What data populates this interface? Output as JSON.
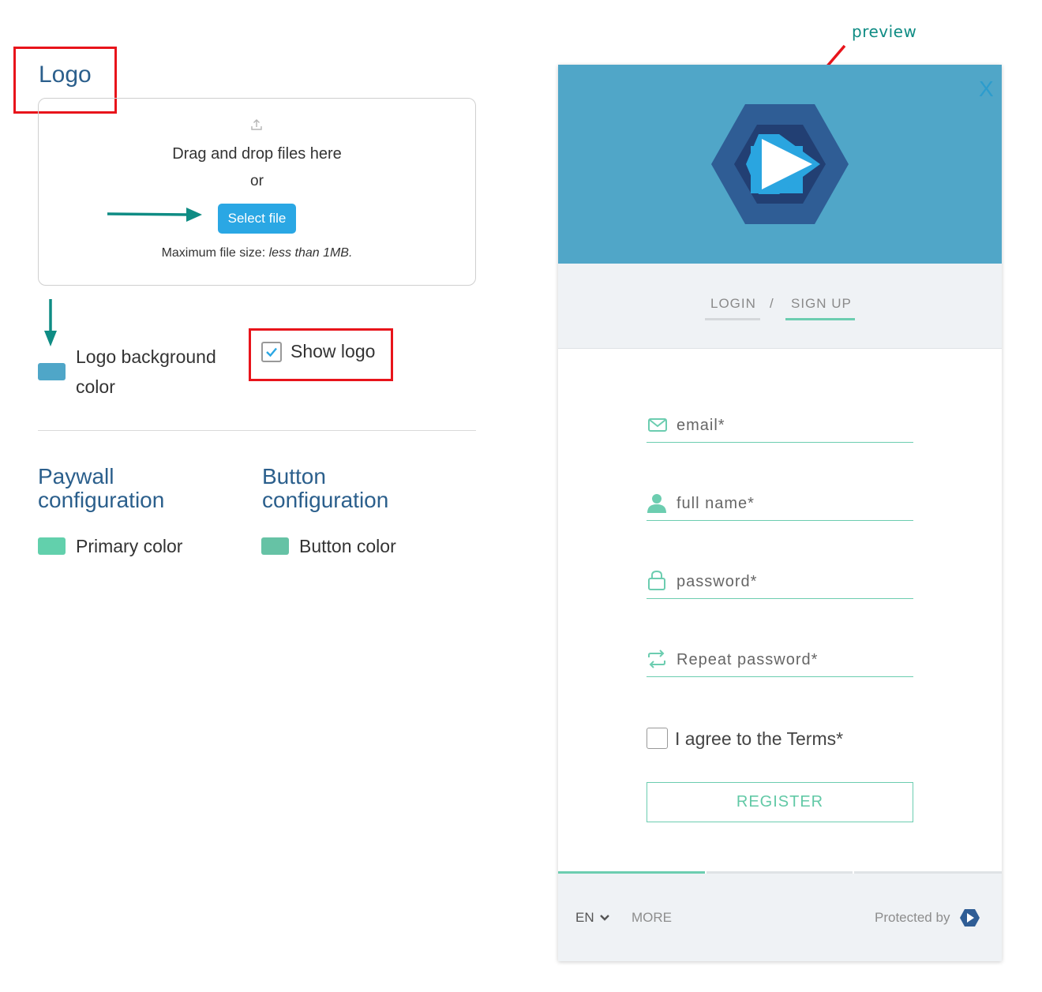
{
  "colors": {
    "heading": "#2b5f8c",
    "highlight_box": "#e8141b",
    "annotation_arrow": "#0f8c84",
    "select_button": "#2aa7e4",
    "logo_background": "#4fa6c8",
    "primary": "#62d0ac",
    "button": "#66c2a5",
    "accent": "#6ccdb0"
  },
  "logo_section": {
    "title": "Logo",
    "upload": {
      "icon": "upload-icon",
      "drag_text": "Drag and drop files here",
      "or_text": "or",
      "select_button": "Select file",
      "max_size_prefix": "Maximum file size:",
      "max_size_value": "less than 1MB."
    },
    "background_color_label_line1": "Logo background",
    "background_color_label_line2": "color",
    "show_logo_label": "Show logo",
    "show_logo_checked": true
  },
  "paywall": {
    "title_line1": "Paywall",
    "title_line2": "configuration",
    "primary_color_label": "Primary color"
  },
  "button_config": {
    "title_line1": "Button",
    "title_line2": "configuration",
    "button_color_label": "Button color"
  },
  "preview": {
    "label": "preview",
    "close": "X",
    "tabs": {
      "login": "LOGIN",
      "separator": "/",
      "signup": "SIGN UP"
    },
    "fields": [
      {
        "icon": "mail-icon",
        "label": "email*"
      },
      {
        "icon": "user-icon",
        "label": "full name*"
      },
      {
        "icon": "lock-icon",
        "label": "password*"
      },
      {
        "icon": "repeat-icon",
        "label": "Repeat password*"
      }
    ],
    "agree_label": "I agree to the Terms*",
    "agree_checked": false,
    "register": "REGISTER",
    "step_progress": {
      "current": 1,
      "total": 3
    },
    "footer": {
      "language": "EN",
      "more": "MORE",
      "protected_by": "Protected by"
    }
  }
}
